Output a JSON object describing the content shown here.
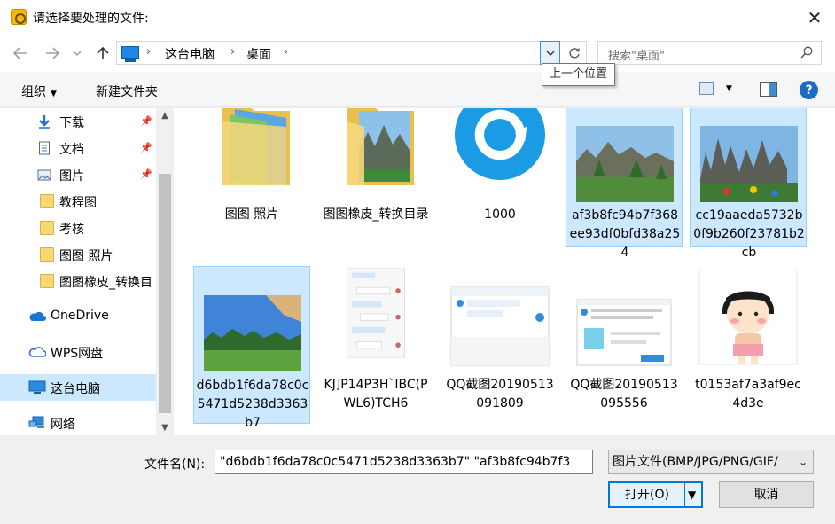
{
  "window": {
    "title": "请选择要处理的文件:",
    "close": "✕"
  },
  "nav": {
    "breadcrumbs": [
      "这台电脑",
      "桌面"
    ],
    "search_placeholder": "搜索\"桌面\"",
    "tooltip": "上一个位置"
  },
  "toolbar": {
    "organize": "组织",
    "new_folder": "新建文件夹",
    "help": "?"
  },
  "sidebar": {
    "items": [
      {
        "label": "下载",
        "icon": "download-icon",
        "pinned": true
      },
      {
        "label": "文档",
        "icon": "document-icon",
        "pinned": true
      },
      {
        "label": "图片",
        "icon": "pictures-icon",
        "pinned": true
      },
      {
        "label": "教程图",
        "icon": "folder-icon"
      },
      {
        "label": "考核",
        "icon": "folder-icon"
      },
      {
        "label": "图图 照片",
        "icon": "folder-icon"
      },
      {
        "label": "图图橡皮_转换目",
        "icon": "folder-icon"
      },
      {
        "label": "OneDrive",
        "icon": "onedrive-cloud-icon"
      },
      {
        "label": "WPS网盘",
        "icon": "wps-cloud-icon"
      },
      {
        "label": "这台电脑",
        "icon": "this-pc-icon",
        "selected": true
      },
      {
        "label": "网络",
        "icon": "network-icon"
      }
    ]
  },
  "files": [
    {
      "name": "图图 照片",
      "kind": "folder"
    },
    {
      "name": "图图橡皮_转换目录",
      "kind": "folder"
    },
    {
      "name": "1000",
      "kind": "image"
    },
    {
      "name": "af3b8fc94b7f368ee93df0bfd38a254",
      "kind": "image",
      "selected": true
    },
    {
      "name": "cc19aaeda5732b0f9b260f23781b2cb",
      "kind": "image",
      "selected": true
    },
    {
      "name": "d6bdb1f6da78c0c5471d5238d3363b7",
      "kind": "image",
      "selected": true
    },
    {
      "name": "KJ]P14P3H`IBC(PWL6)TCH6",
      "kind": "image"
    },
    {
      "name": "QQ截图20190513091809",
      "kind": "image"
    },
    {
      "name": "QQ截图20190513095556",
      "kind": "image"
    },
    {
      "name": "t0153af7a3af9ec4d3e",
      "kind": "image"
    }
  ],
  "footer": {
    "filename_label": "文件名(N):",
    "filename_value": "\"d6bdb1f6da78c0c5471d5238d3363b7\" \"af3b8fc94b7f3",
    "filetype": "图片文件(BMP/JPG/PNG/GIF/",
    "open": "打开(O)",
    "cancel": "取消"
  }
}
